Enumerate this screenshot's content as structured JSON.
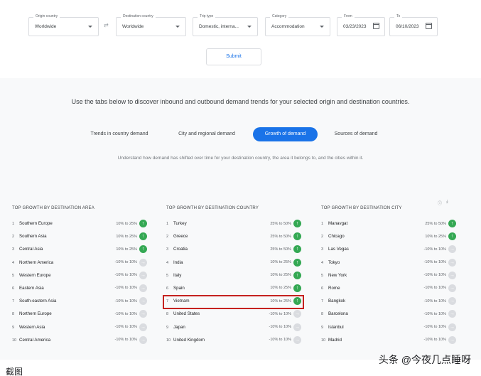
{
  "filters": {
    "origin": {
      "label": "Origin country",
      "value": "Worldwide"
    },
    "destination": {
      "label": "Destination country",
      "value": "Worldwide"
    },
    "trip_type": {
      "label": "Trip type",
      "value": "Domestic, interna..."
    },
    "category": {
      "label": "Category",
      "value": "Accommodation"
    },
    "from": {
      "label": "From",
      "value": "03/23/2023"
    },
    "to": {
      "label": "To",
      "value": "06/10/2023"
    },
    "swap_glyph": "⇄",
    "submit_label": "Submit"
  },
  "headline": "Use the tabs below to discover inbound and outbound demand trends for your selected origin and destination countries.",
  "tabs": [
    {
      "label": "Trends in country demand",
      "active": false
    },
    {
      "label": "City and regional demand",
      "active": false
    },
    {
      "label": "Growth of demand",
      "active": true
    },
    {
      "label": "Sources of demand",
      "active": false
    }
  ],
  "description": "Understand how demand has shifted over time for your destination country, the area it belongs to, and the cities within it.",
  "icons": {
    "info": "ⓘ",
    "download": "⤓"
  },
  "columns": [
    {
      "title": "TOP GROWTH BY DESTINATION AREA",
      "rows": [
        {
          "rank": "1",
          "name": "Southern Europe",
          "range": "10% to 25%",
          "trend": "up"
        },
        {
          "rank": "2",
          "name": "Southern Asia",
          "range": "10% to 25%",
          "trend": "up"
        },
        {
          "rank": "3",
          "name": "Central Asia",
          "range": "10% to 25%",
          "trend": "up"
        },
        {
          "rank": "4",
          "name": "Northern America",
          "range": "-10% to 10%",
          "trend": "flat"
        },
        {
          "rank": "5",
          "name": "Western Europe",
          "range": "-10% to 10%",
          "trend": "flat"
        },
        {
          "rank": "6",
          "name": "Eastern Asia",
          "range": "-10% to 10%",
          "trend": "flat"
        },
        {
          "rank": "7",
          "name": "South-eastern Asia",
          "range": "-10% to 10%",
          "trend": "flat"
        },
        {
          "rank": "8",
          "name": "Northern Europe",
          "range": "-10% to 10%",
          "trend": "flat"
        },
        {
          "rank": "9",
          "name": "Western Asia",
          "range": "-10% to 10%",
          "trend": "flat"
        },
        {
          "rank": "10",
          "name": "Central America",
          "range": "-10% to 10%",
          "trend": "flat"
        }
      ]
    },
    {
      "title": "TOP GROWTH BY DESTINATION COUNTRY",
      "rows": [
        {
          "rank": "1",
          "name": "Turkey",
          "range": "25% to 50%",
          "trend": "up"
        },
        {
          "rank": "2",
          "name": "Greece",
          "range": "25% to 50%",
          "trend": "up"
        },
        {
          "rank": "3",
          "name": "Croatia",
          "range": "25% to 50%",
          "trend": "up"
        },
        {
          "rank": "4",
          "name": "India",
          "range": "10% to 25%",
          "trend": "up"
        },
        {
          "rank": "5",
          "name": "Italy",
          "range": "10% to 25%",
          "trend": "up"
        },
        {
          "rank": "6",
          "name": "Spain",
          "range": "10% to 25%",
          "trend": "up"
        },
        {
          "rank": "7",
          "name": "Vietnam",
          "range": "10% to 25%",
          "trend": "up"
        },
        {
          "rank": "8",
          "name": "United States",
          "range": "-10% to 10%",
          "trend": "flat"
        },
        {
          "rank": "9",
          "name": "Japan",
          "range": "-10% to 10%",
          "trend": "flat"
        },
        {
          "rank": "10",
          "name": "United Kingdom",
          "range": "-10% to 10%",
          "trend": "flat"
        }
      ]
    },
    {
      "title": "TOP GROWTH BY DESTINATION CITY",
      "rows": [
        {
          "rank": "1",
          "name": "Manavgat",
          "range": "25% to 50%",
          "trend": "up"
        },
        {
          "rank": "2",
          "name": "Chicago",
          "range": "10% to 25%",
          "trend": "up"
        },
        {
          "rank": "3",
          "name": "Las Vegas",
          "range": "-10% to 10%",
          "trend": "flat"
        },
        {
          "rank": "4",
          "name": "Tokyo",
          "range": "-10% to 10%",
          "trend": "flat"
        },
        {
          "rank": "5",
          "name": "New York",
          "range": "-10% to 10%",
          "trend": "flat"
        },
        {
          "rank": "6",
          "name": "Rome",
          "range": "-10% to 10%",
          "trend": "flat"
        },
        {
          "rank": "7",
          "name": "Bangkok",
          "range": "-10% to 10%",
          "trend": "flat"
        },
        {
          "rank": "8",
          "name": "Barcelona",
          "range": "-10% to 10%",
          "trend": "flat"
        },
        {
          "rank": "9",
          "name": "Istanbul",
          "range": "-10% to 10%",
          "trend": "flat"
        },
        {
          "rank": "10",
          "name": "Madrid",
          "range": "-10% to 10%",
          "trend": "flat"
        }
      ]
    }
  ],
  "arrow_glyphs": {
    "up": "↑",
    "flat": "→"
  },
  "colors": {
    "accent": "#1a73e8",
    "up": "#34a853",
    "flat": "#dadce0",
    "highlight": "#c5221f"
  },
  "caption": "截图",
  "watermark": "头条 @今夜几点睡呀"
}
